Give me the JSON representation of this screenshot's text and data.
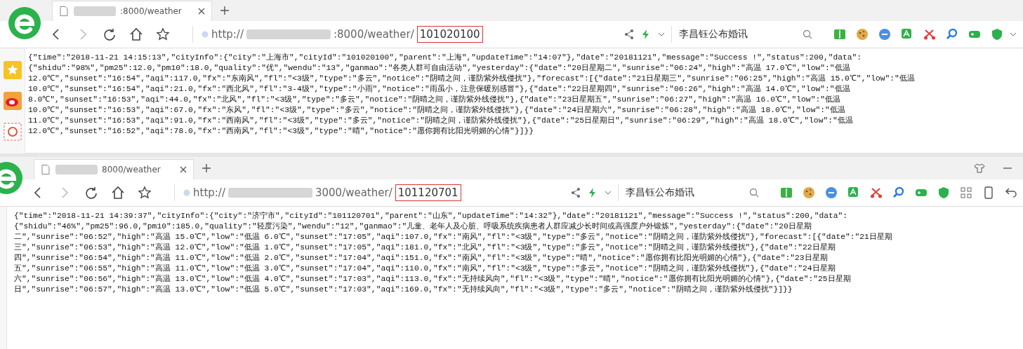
{
  "windows": [
    {
      "kind": "sidebar",
      "tab": {
        "title": ":8000/weather"
      },
      "address": {
        "scheme": "http://",
        "path": ":8000/weather/",
        "highlighted": "101020100"
      },
      "search": {
        "value": "李昌钰公布婚讯"
      },
      "content_lines": [
        "{\"time\":\"2018-11-21 14:15:13\",\"cityInfo\":{\"city\":\"上海市\",\"cityId\":\"101020100\",\"parent\":\"上海\",\"updateTime\":\"14:07\"},\"date\":\"20181121\",\"message\":\"Success !\",\"status\":200,\"data\":",
        "{\"shidu\":\"98%\",\"pm25\":12.0,\"pm10\":18.0,\"quality\":\"优\",\"wendu\":\"13\",\"ganmao\":\"各类人群可自由活动\",\"yesterday\":{\"date\":\"20日星期二\",\"sunrise\":\"06:24\",\"high\":\"高温 17.0℃\",\"low\":\"低温",
        "12.0℃\",\"sunset\":\"16:54\",\"aqi\":117.0,\"fx\":\"东南风\",\"fl\":\"<3级\",\"type\":\"多云\",\"notice\":\"阴晴之间，谨防紫外线侵扰\"},\"forecast\":[{\"date\":\"21日星期三\",\"sunrise\":\"06:25\",\"high\":\"高温 15.0℃\",\"low\":\"低温",
        "10.0℃\",\"sunset\":\"16:54\",\"aqi\":21.0,\"fx\":\"西北风\",\"fl\":\"3-4级\",\"type\":\"小雨\",\"notice\":\"雨虽小，注意保暖别感冒\"},{\"date\":\"22日星期四\",\"sunrise\":\"06:26\",\"high\":\"高温 14.0℃\",\"low\":\"低温",
        "8.0℃\",\"sunset\":\"16:53\",\"aqi\":44.0,\"fx\":\"北风\",\"fl\":\"<3级\",\"type\":\"多云\",\"notice\":\"阴晴之间，谨防紫外线侵扰\"},{\"date\":\"23日星期五\",\"sunrise\":\"06:27\",\"high\":\"高温 16.0℃\",\"low\":\"低温",
        "10.0℃\",\"sunset\":\"16:53\",\"aqi\":67.0,\"fx\":\"东风\",\"fl\":\"<3级\",\"type\":\"多云\",\"notice\":\"阴晴之间，谨防紫外线侵扰\"},{\"date\":\"24日星期六\",\"sunrise\":\"06:28\",\"high\":\"高温 18.0℃\",\"low\":\"低温",
        "11.0℃\",\"sunset\":\"16:53\",\"aqi\":91.0,\"fx\":\"西南风\",\"fl\":\"<3级\",\"type\":\"多云\",\"notice\":\"阴晴之间，谨防紫外线侵扰\"},{\"date\":\"25日星期日\",\"sunrise\":\"06:29\",\"high\":\"高温 18.0℃\",\"low\":\"低温",
        "12.0℃\",\"sunset\":\"16:52\",\"aqi\":78.0,\"fx\":\"西南风\",\"fl\":\"<3级\",\"type\":\"晴\",\"notice\":\"愿你拥有比阳光明媚的心情\"}]}}"
      ]
    },
    {
      "kind": "plain",
      "tab": {
        "title": "8000/weather"
      },
      "address": {
        "scheme": "http://",
        "path": "3000/weather/",
        "highlighted": "101120701"
      },
      "search": {
        "value": "李昌钰公布婚讯"
      },
      "content_lines": [
        "{\"time\":\"2018-11-21 14:39:37\",\"cityInfo\":{\"city\":\"济宁市\",\"cityId\":\"101120701\",\"parent\":\"山东\",\"updateTime\":\"14:32\"},\"date\":\"20181121\",\"message\":\"Success !\",\"status\":200,\"data\":",
        "{\"shidu\":\"46%\",\"pm25\":96.0,\"pm10\":185.0,\"quality\":\"轻度污染\",\"wendu\":\"12\",\"ganmao\":\"儿童、老年人及心脏、呼吸系统疾病患者人群应减少长时间或高强度户外锻炼\",\"yesterday\":{\"date\":\"20日星期",
        "二\",\"sunrise\":\"06:52\",\"high\":\"高温 15.0℃\",\"low\":\"低温 6.0℃\",\"sunset\":\"17:05\",\"aqi\":107.0,\"fx\":\"南风\",\"fl\":\"<3级\",\"type\":\"多云\",\"notice\":\"阴晴之间，谨防紫外线侵扰\"},\"forecast\":[{\"date\":\"21日星期",
        "三\",\"sunrise\":\"06:53\",\"high\":\"高温 12.0℃\",\"low\":\"低温 1.0℃\",\"sunset\":\"17:05\",\"aqi\":181.0,\"fx\":\"北风\",\"fl\":\"<3级\",\"type\":\"多云\",\"notice\":\"阴晴之间，谨防紫外线侵扰\"},{\"date\":\"22日星期",
        "四\",\"sunrise\":\"06:54\",\"high\":\"高温 11.0℃\",\"low\":\"低温 2.0℃\",\"sunset\":\"17:04\",\"aqi\":151.0,\"fx\":\"南风\",\"fl\":\"<3级\",\"type\":\"晴\",\"notice\":\"愿你拥有比阳光明媚的心情\"},{\"date\":\"23日星期",
        "五\",\"sunrise\":\"06:55\",\"high\":\"高温 11.0℃\",\"low\":\"低温 3.0℃\",\"sunset\":\"17:04\",\"aqi\":110.0,\"fx\":\"南风\",\"fl\":\"<3级\",\"type\":\"多云\",\"notice\":\"阴晴之间，谨防紫外线侵扰\"},{\"date\":\"24日星期",
        "六\",\"sunrise\":\"06:56\",\"high\":\"高温 13.0℃\",\"low\":\"低温 4.0℃\",\"sunset\":\"17:03\",\"aqi\":113.0,\"fx\":\"无持续风向\",\"fl\":\"<3级\",\"type\":\"晴\",\"notice\":\"愿你拥有比阳光明媚的心情\"},{\"date\":\"25日星期",
        "日\",\"sunrise\":\"06:57\",\"high\":\"高温 13.0℃\",\"low\":\"低温 5.0℃\",\"sunset\":\"17:03\",\"aqi\":169.0,\"fx\":\"无持续风向\",\"fl\":\"<3级\",\"type\":\"多云\",\"notice\":\"阴晴之间，谨防紫外线侵扰\"}]}}"
      ]
    }
  ]
}
